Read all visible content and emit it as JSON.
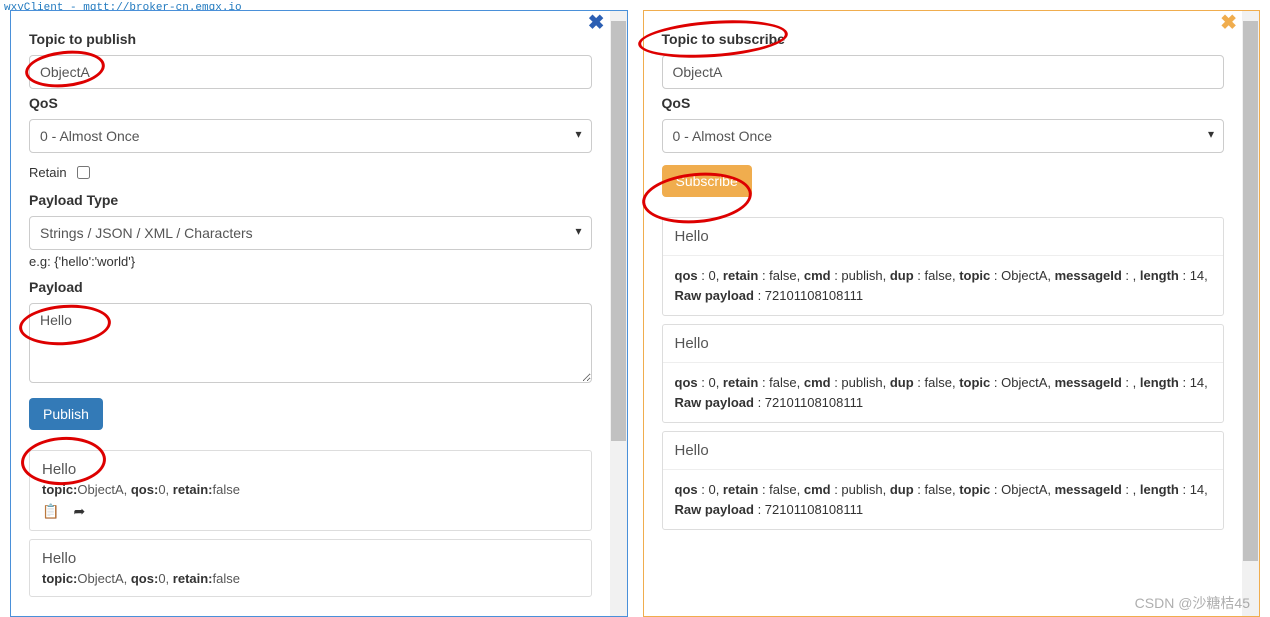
{
  "title_bar": "wxyClient - mqtt://broker-cn.emqx.io",
  "publish": {
    "title": "Topic to publish",
    "topic_value": "ObjectA",
    "qos_label": "QoS",
    "qos_selected": "0 - Almost Once",
    "retain_label": "Retain",
    "payload_type_label": "Payload Type",
    "payload_type_selected": "Strings / JSON / XML / Characters",
    "payload_type_hint": "e.g: {'hello':'world'}",
    "payload_label": "Payload",
    "payload_value": "Hello",
    "publish_button": "Publish",
    "messages": [
      {
        "payload": "Hello",
        "meta_html": "<b>topic:</b>ObjectA, <b>qos:</b>0, <b>retain:</b>false",
        "show_icons": true
      },
      {
        "payload": "Hello",
        "meta_html": "<b>topic:</b>ObjectA, <b>qos:</b>0, <b>retain:</b>false",
        "show_icons": false
      }
    ]
  },
  "subscribe": {
    "title": "Topic to subscribe",
    "topic_value": "ObjectA",
    "qos_label": "QoS",
    "qos_selected": "0 - Almost Once",
    "subscribe_button": "Subscribe",
    "messages": [
      {
        "payload": "Hello",
        "detail_html": "<b>qos</b> : 0, <b>retain</b> : false, <b>cmd</b> : publish, <b>dup</b> : false, <b>topic</b> : ObjectA, <b>messageId</b> : , <b>length</b> : 14, <b>Raw payload</b> : 72101108108111"
      },
      {
        "payload": "Hello",
        "detail_html": "<b>qos</b> : 0, <b>retain</b> : false, <b>cmd</b> : publish, <b>dup</b> : false, <b>topic</b> : ObjectA, <b>messageId</b> : , <b>length</b> : 14, <b>Raw payload</b> : 72101108108111"
      },
      {
        "payload": "Hello",
        "detail_html": "<b>qos</b> : 0, <b>retain</b> : false, <b>cmd</b> : publish, <b>dup</b> : false, <b>topic</b> : ObjectA, <b>messageId</b> : , <b>length</b> : 14, <b>Raw payload</b> : 72101108108111"
      }
    ]
  },
  "watermark": "CSDN @沙糖桔45"
}
